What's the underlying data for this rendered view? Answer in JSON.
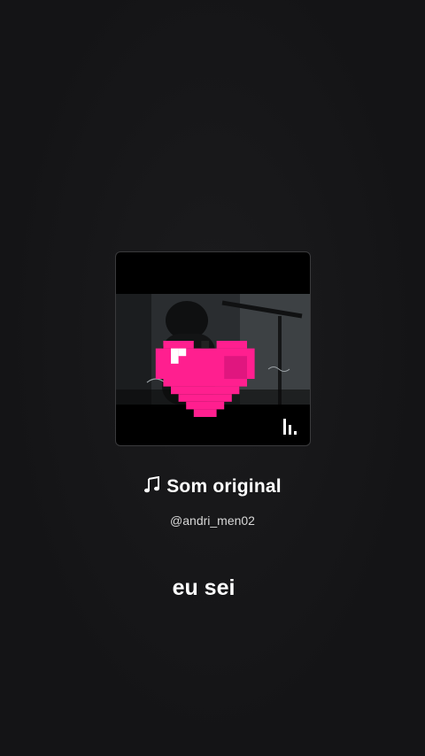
{
  "sound": {
    "title": "Som original",
    "author": "@andri_men02",
    "icon": "music-note-icon"
  },
  "caption": "eu sei",
  "cover": {
    "overlay_icon": "pixel-heart-icon",
    "corner_icon": "sound-bars-icon",
    "heart_color": "#ff1f8f"
  }
}
